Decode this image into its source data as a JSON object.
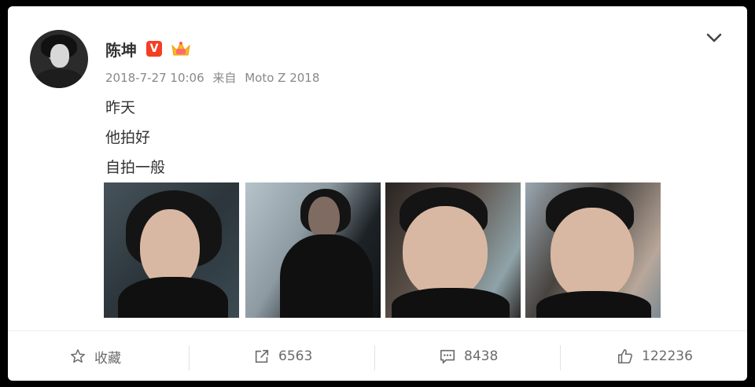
{
  "post": {
    "username": "陈坤",
    "verified_badge": "V",
    "badges": [
      "verified-badge",
      "crown-icon"
    ],
    "timestamp": "2018-7-27 10:06",
    "source_prefix": "来自",
    "source": "Moto Z 2018",
    "lines": [
      "昨天",
      "他拍好",
      "自拍一般"
    ],
    "photos": [
      "photo-1",
      "photo-2",
      "photo-3",
      "photo-4"
    ]
  },
  "actions": {
    "favorite_label": "收藏",
    "repost_count": "6563",
    "comment_count": "8438",
    "like_count": "122236"
  },
  "colors": {
    "verified_red": "#f43e23",
    "text_dark": "#333333",
    "text_muted": "#888888"
  }
}
